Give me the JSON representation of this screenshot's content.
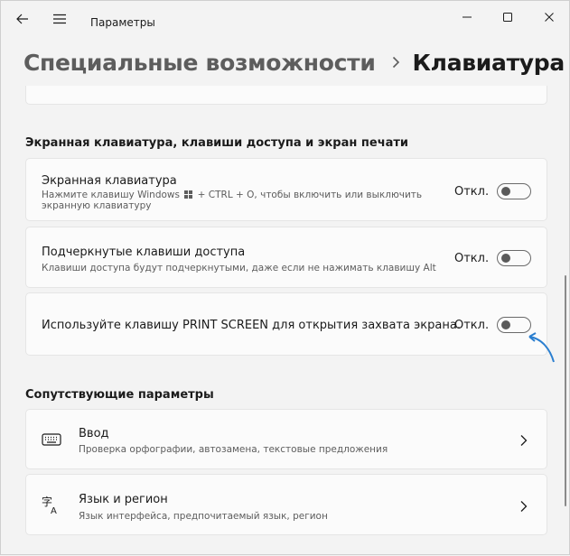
{
  "titlebar": {
    "app_title": "Параметры"
  },
  "header": {
    "parent": "Специальные возможности",
    "current": "Клавиатура"
  },
  "section_keyboard": {
    "title": "Экранная клавиатура, клавиши доступа и экран печати",
    "items": [
      {
        "title": "Экранная клавиатура",
        "desc_before": "Нажмите клавишу Windows",
        "desc_after": "+ CTRL + O, чтобы включить или выключить",
        "desc_line2": "экранную клавиатуру",
        "state": "Откл."
      },
      {
        "title": "Подчеркнутые клавиши доступа",
        "desc": "Клавиши доступа будут подчеркнутыми, даже если не нажимать клавишу Alt",
        "state": "Откл."
      },
      {
        "title": "Используйте клавишу PRINT SCREEN для открытия захвата экрана.",
        "state": "Откл."
      }
    ]
  },
  "section_related": {
    "title": "Сопутствующие параметры",
    "items": [
      {
        "icon": "keyboard-icon",
        "title": "Ввод",
        "desc": "Проверка орфографии, автозамена, текстовые предложения"
      },
      {
        "icon": "language-icon",
        "title": "Язык и регион",
        "desc": "Язык интерфейса, предпочитаемый язык, регион"
      }
    ]
  },
  "colors": {
    "annotation_arrow": "#2b7fd0",
    "toggle_off_knob": "#5a5a5a"
  }
}
